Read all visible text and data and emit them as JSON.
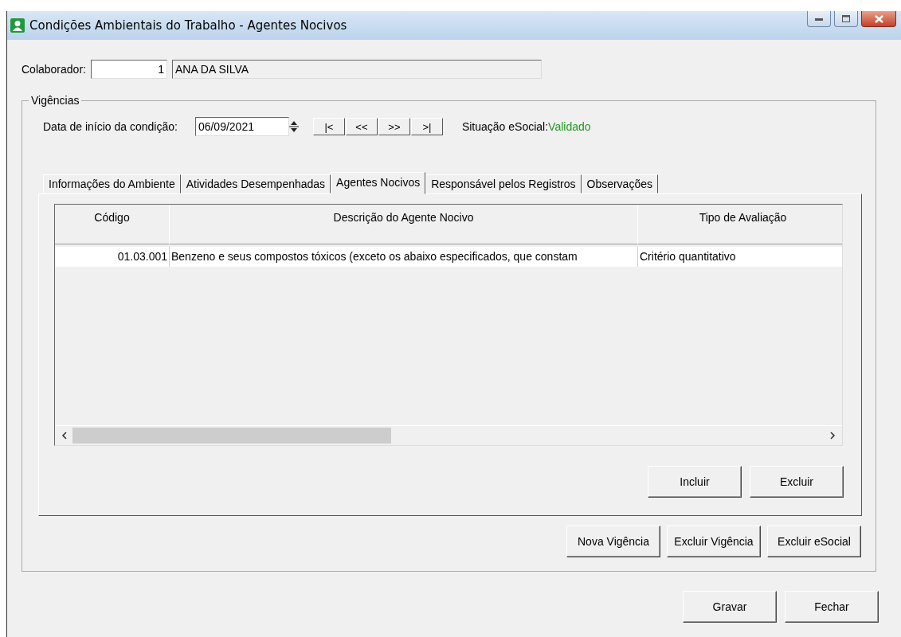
{
  "window": {
    "title": "Condições Ambientais do Trabalho - Agentes Nocivos"
  },
  "colaborador": {
    "label": "Colaborador:",
    "code": "1",
    "name": "ANA DA SILVA"
  },
  "vigencias": {
    "legend": "Vigências",
    "date_label": "Data de início da condição:",
    "date": "06/09/2021",
    "nav_buttons": [
      "|<",
      "<<",
      ">>",
      ">|"
    ],
    "status_label": "Situação eSocial:",
    "status": "Validado"
  },
  "tabs": [
    {
      "label": "Informações do Ambiente",
      "selected": false
    },
    {
      "label": "Atividades Desempenhadas",
      "selected": false
    },
    {
      "label": "Agentes Nocivos",
      "selected": true
    },
    {
      "label": "Responsável pelos Registros",
      "selected": false
    },
    {
      "label": "Observações",
      "selected": false
    }
  ],
  "table": {
    "columns": [
      "Código",
      "Descrição do Agente Nocivo",
      "Tipo de Avaliação"
    ],
    "rows": [
      {
        "cells": [
          "01.03.001",
          "Benzeno e seus compostos tóxicos (exceto os abaixo especificados, que constam",
          "Critério quantitativo"
        ],
        "selected": false
      }
    ]
  },
  "tab_buttons": [
    "Incluir",
    "Excluir"
  ],
  "vigencia_buttons": [
    "Nova Vigência",
    "Excluir Vigência",
    "Excluir eSocial"
  ],
  "footer_buttons": [
    "Gravar",
    "Fechar"
  ]
}
